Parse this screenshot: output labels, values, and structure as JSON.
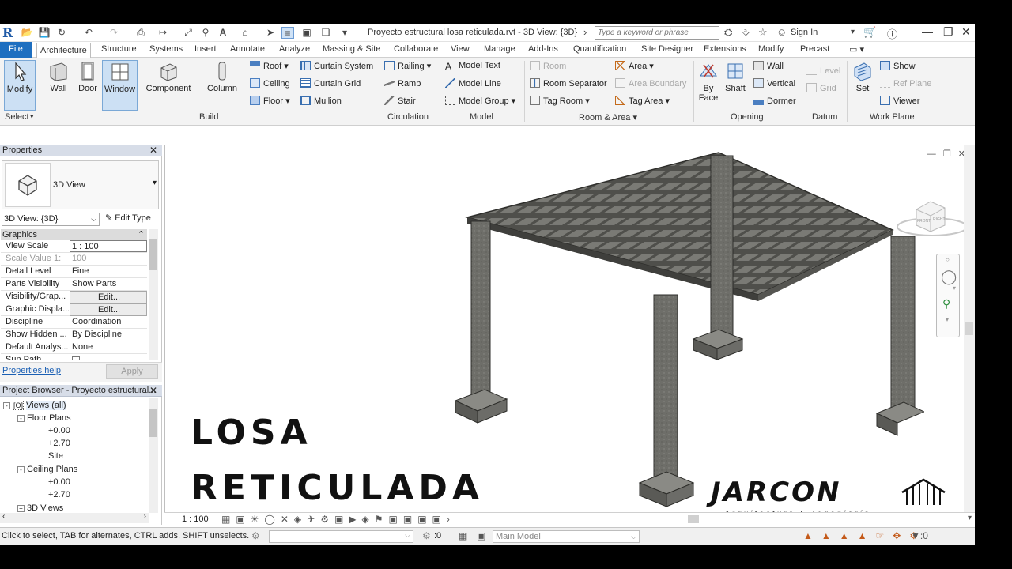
{
  "app": {
    "document_title": "Proyecto estructural losa reticulada.rvt - 3D View: {3D}",
    "search_placeholder": "Type a keyword or phrase",
    "sign_in": "Sign In"
  },
  "tabs": [
    "File",
    "Architecture",
    "Structure",
    "Systems",
    "Insert",
    "Annotate",
    "Analyze",
    "Massing & Site",
    "Collaborate",
    "View",
    "Manage",
    "Add-Ins",
    "Quantification",
    "Site Designer",
    "Extensions",
    "Modify",
    "Precast"
  ],
  "ribbon": {
    "select": {
      "modify": "Modify",
      "title": "Select"
    },
    "build": {
      "title": "Build",
      "wall": "Wall",
      "door": "Door",
      "window": "Window",
      "component": "Component",
      "column": "Column",
      "roof": "Roof",
      "ceiling": "Ceiling",
      "floor": "Floor",
      "curtain_system": "Curtain System",
      "curtain_grid": "Curtain Grid",
      "mullion": "Mullion"
    },
    "circulation": {
      "title": "Circulation",
      "railing": "Railing",
      "ramp": "Ramp",
      "stair": "Stair"
    },
    "model": {
      "title": "Model",
      "model_text": "Model Text",
      "model_line": "Model Line",
      "model_group": "Model Group"
    },
    "room_area": {
      "title": "Room & Area",
      "room": "Room",
      "room_separator": "Room Separator",
      "tag_room": "Tag Room",
      "area": "Area",
      "area_boundary": "Area Boundary",
      "tag_area": "Tag Area"
    },
    "opening": {
      "title": "Opening",
      "by_face_1": "By",
      "by_face_2": "Face",
      "shaft": "Shaft",
      "wall": "Wall",
      "vertical": "Vertical",
      "dormer": "Dormer"
    },
    "datum": {
      "title": "Datum",
      "level": "Level",
      "grid": "Grid"
    },
    "work_plane": {
      "title": "Work Plane",
      "set": "Set",
      "show": "Show",
      "ref_plane": "Ref Plane",
      "viewer": "Viewer"
    }
  },
  "properties": {
    "title": "Properties",
    "type_name": "3D View",
    "view_selector": "3D View: {3D}",
    "edit_type": "Edit Type",
    "group": "Graphics",
    "rows": [
      {
        "k": "View Scale",
        "v": "1 : 100"
      },
      {
        "k": "Scale Value    1:",
        "v": "100"
      },
      {
        "k": "Detail Level",
        "v": "Fine"
      },
      {
        "k": "Parts Visibility",
        "v": "Show Parts"
      },
      {
        "k": "Visibility/Grap...",
        "v": "Edit..."
      },
      {
        "k": "Graphic Displa...",
        "v": "Edit..."
      },
      {
        "k": "Discipline",
        "v": "Coordination"
      },
      {
        "k": "Show Hidden ...",
        "v": "By Discipline"
      },
      {
        "k": "Default Analys...",
        "v": "None"
      },
      {
        "k": "Sun Path",
        "v": ""
      }
    ],
    "help": "Properties help",
    "apply": "Apply"
  },
  "browser": {
    "title": "Project Browser - Proyecto estructural...",
    "items": [
      "Views (all)",
      "Floor Plans",
      "+0.00",
      "+2.70",
      "Site",
      "Ceiling Plans",
      "+0.00",
      "+2.70",
      "3D Views"
    ]
  },
  "viewport": {
    "title_line1": "LOSA",
    "title_line2": "RETICULADA",
    "brand": "JARCON",
    "brand_sub": "Arquitectura E Ingeniería",
    "cube_front": "FRONT",
    "cube_right": "RIGHT",
    "scale": "1 : 100"
  },
  "status": {
    "text": "Click to select, TAB for alternates, CTRL adds, SHIFT unselects.",
    "zero": ":0",
    "model": "Main Model"
  },
  "colors": {
    "accent": "#1e6fc0",
    "concrete": "#6b6b67"
  }
}
